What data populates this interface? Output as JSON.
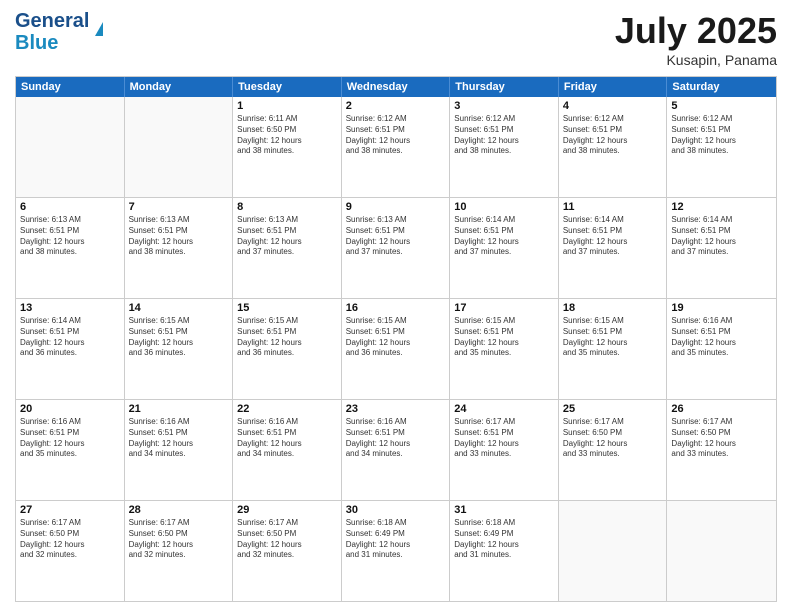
{
  "header": {
    "logo_line1": "General",
    "logo_line2": "Blue",
    "month_title": "July 2025",
    "subtitle": "Kusapin, Panama"
  },
  "days_of_week": [
    "Sunday",
    "Monday",
    "Tuesday",
    "Wednesday",
    "Thursday",
    "Friday",
    "Saturday"
  ],
  "weeks": [
    [
      {
        "day": "",
        "info": ""
      },
      {
        "day": "",
        "info": ""
      },
      {
        "day": "1",
        "info": "Sunrise: 6:11 AM\nSunset: 6:50 PM\nDaylight: 12 hours\nand 38 minutes."
      },
      {
        "day": "2",
        "info": "Sunrise: 6:12 AM\nSunset: 6:51 PM\nDaylight: 12 hours\nand 38 minutes."
      },
      {
        "day": "3",
        "info": "Sunrise: 6:12 AM\nSunset: 6:51 PM\nDaylight: 12 hours\nand 38 minutes."
      },
      {
        "day": "4",
        "info": "Sunrise: 6:12 AM\nSunset: 6:51 PM\nDaylight: 12 hours\nand 38 minutes."
      },
      {
        "day": "5",
        "info": "Sunrise: 6:12 AM\nSunset: 6:51 PM\nDaylight: 12 hours\nand 38 minutes."
      }
    ],
    [
      {
        "day": "6",
        "info": "Sunrise: 6:13 AM\nSunset: 6:51 PM\nDaylight: 12 hours\nand 38 minutes."
      },
      {
        "day": "7",
        "info": "Sunrise: 6:13 AM\nSunset: 6:51 PM\nDaylight: 12 hours\nand 38 minutes."
      },
      {
        "day": "8",
        "info": "Sunrise: 6:13 AM\nSunset: 6:51 PM\nDaylight: 12 hours\nand 37 minutes."
      },
      {
        "day": "9",
        "info": "Sunrise: 6:13 AM\nSunset: 6:51 PM\nDaylight: 12 hours\nand 37 minutes."
      },
      {
        "day": "10",
        "info": "Sunrise: 6:14 AM\nSunset: 6:51 PM\nDaylight: 12 hours\nand 37 minutes."
      },
      {
        "day": "11",
        "info": "Sunrise: 6:14 AM\nSunset: 6:51 PM\nDaylight: 12 hours\nand 37 minutes."
      },
      {
        "day": "12",
        "info": "Sunrise: 6:14 AM\nSunset: 6:51 PM\nDaylight: 12 hours\nand 37 minutes."
      }
    ],
    [
      {
        "day": "13",
        "info": "Sunrise: 6:14 AM\nSunset: 6:51 PM\nDaylight: 12 hours\nand 36 minutes."
      },
      {
        "day": "14",
        "info": "Sunrise: 6:15 AM\nSunset: 6:51 PM\nDaylight: 12 hours\nand 36 minutes."
      },
      {
        "day": "15",
        "info": "Sunrise: 6:15 AM\nSunset: 6:51 PM\nDaylight: 12 hours\nand 36 minutes."
      },
      {
        "day": "16",
        "info": "Sunrise: 6:15 AM\nSunset: 6:51 PM\nDaylight: 12 hours\nand 36 minutes."
      },
      {
        "day": "17",
        "info": "Sunrise: 6:15 AM\nSunset: 6:51 PM\nDaylight: 12 hours\nand 35 minutes."
      },
      {
        "day": "18",
        "info": "Sunrise: 6:15 AM\nSunset: 6:51 PM\nDaylight: 12 hours\nand 35 minutes."
      },
      {
        "day": "19",
        "info": "Sunrise: 6:16 AM\nSunset: 6:51 PM\nDaylight: 12 hours\nand 35 minutes."
      }
    ],
    [
      {
        "day": "20",
        "info": "Sunrise: 6:16 AM\nSunset: 6:51 PM\nDaylight: 12 hours\nand 35 minutes."
      },
      {
        "day": "21",
        "info": "Sunrise: 6:16 AM\nSunset: 6:51 PM\nDaylight: 12 hours\nand 34 minutes."
      },
      {
        "day": "22",
        "info": "Sunrise: 6:16 AM\nSunset: 6:51 PM\nDaylight: 12 hours\nand 34 minutes."
      },
      {
        "day": "23",
        "info": "Sunrise: 6:16 AM\nSunset: 6:51 PM\nDaylight: 12 hours\nand 34 minutes."
      },
      {
        "day": "24",
        "info": "Sunrise: 6:17 AM\nSunset: 6:51 PM\nDaylight: 12 hours\nand 33 minutes."
      },
      {
        "day": "25",
        "info": "Sunrise: 6:17 AM\nSunset: 6:50 PM\nDaylight: 12 hours\nand 33 minutes."
      },
      {
        "day": "26",
        "info": "Sunrise: 6:17 AM\nSunset: 6:50 PM\nDaylight: 12 hours\nand 33 minutes."
      }
    ],
    [
      {
        "day": "27",
        "info": "Sunrise: 6:17 AM\nSunset: 6:50 PM\nDaylight: 12 hours\nand 32 minutes."
      },
      {
        "day": "28",
        "info": "Sunrise: 6:17 AM\nSunset: 6:50 PM\nDaylight: 12 hours\nand 32 minutes."
      },
      {
        "day": "29",
        "info": "Sunrise: 6:17 AM\nSunset: 6:50 PM\nDaylight: 12 hours\nand 32 minutes."
      },
      {
        "day": "30",
        "info": "Sunrise: 6:18 AM\nSunset: 6:49 PM\nDaylight: 12 hours\nand 31 minutes."
      },
      {
        "day": "31",
        "info": "Sunrise: 6:18 AM\nSunset: 6:49 PM\nDaylight: 12 hours\nand 31 minutes."
      },
      {
        "day": "",
        "info": ""
      },
      {
        "day": "",
        "info": ""
      }
    ]
  ]
}
